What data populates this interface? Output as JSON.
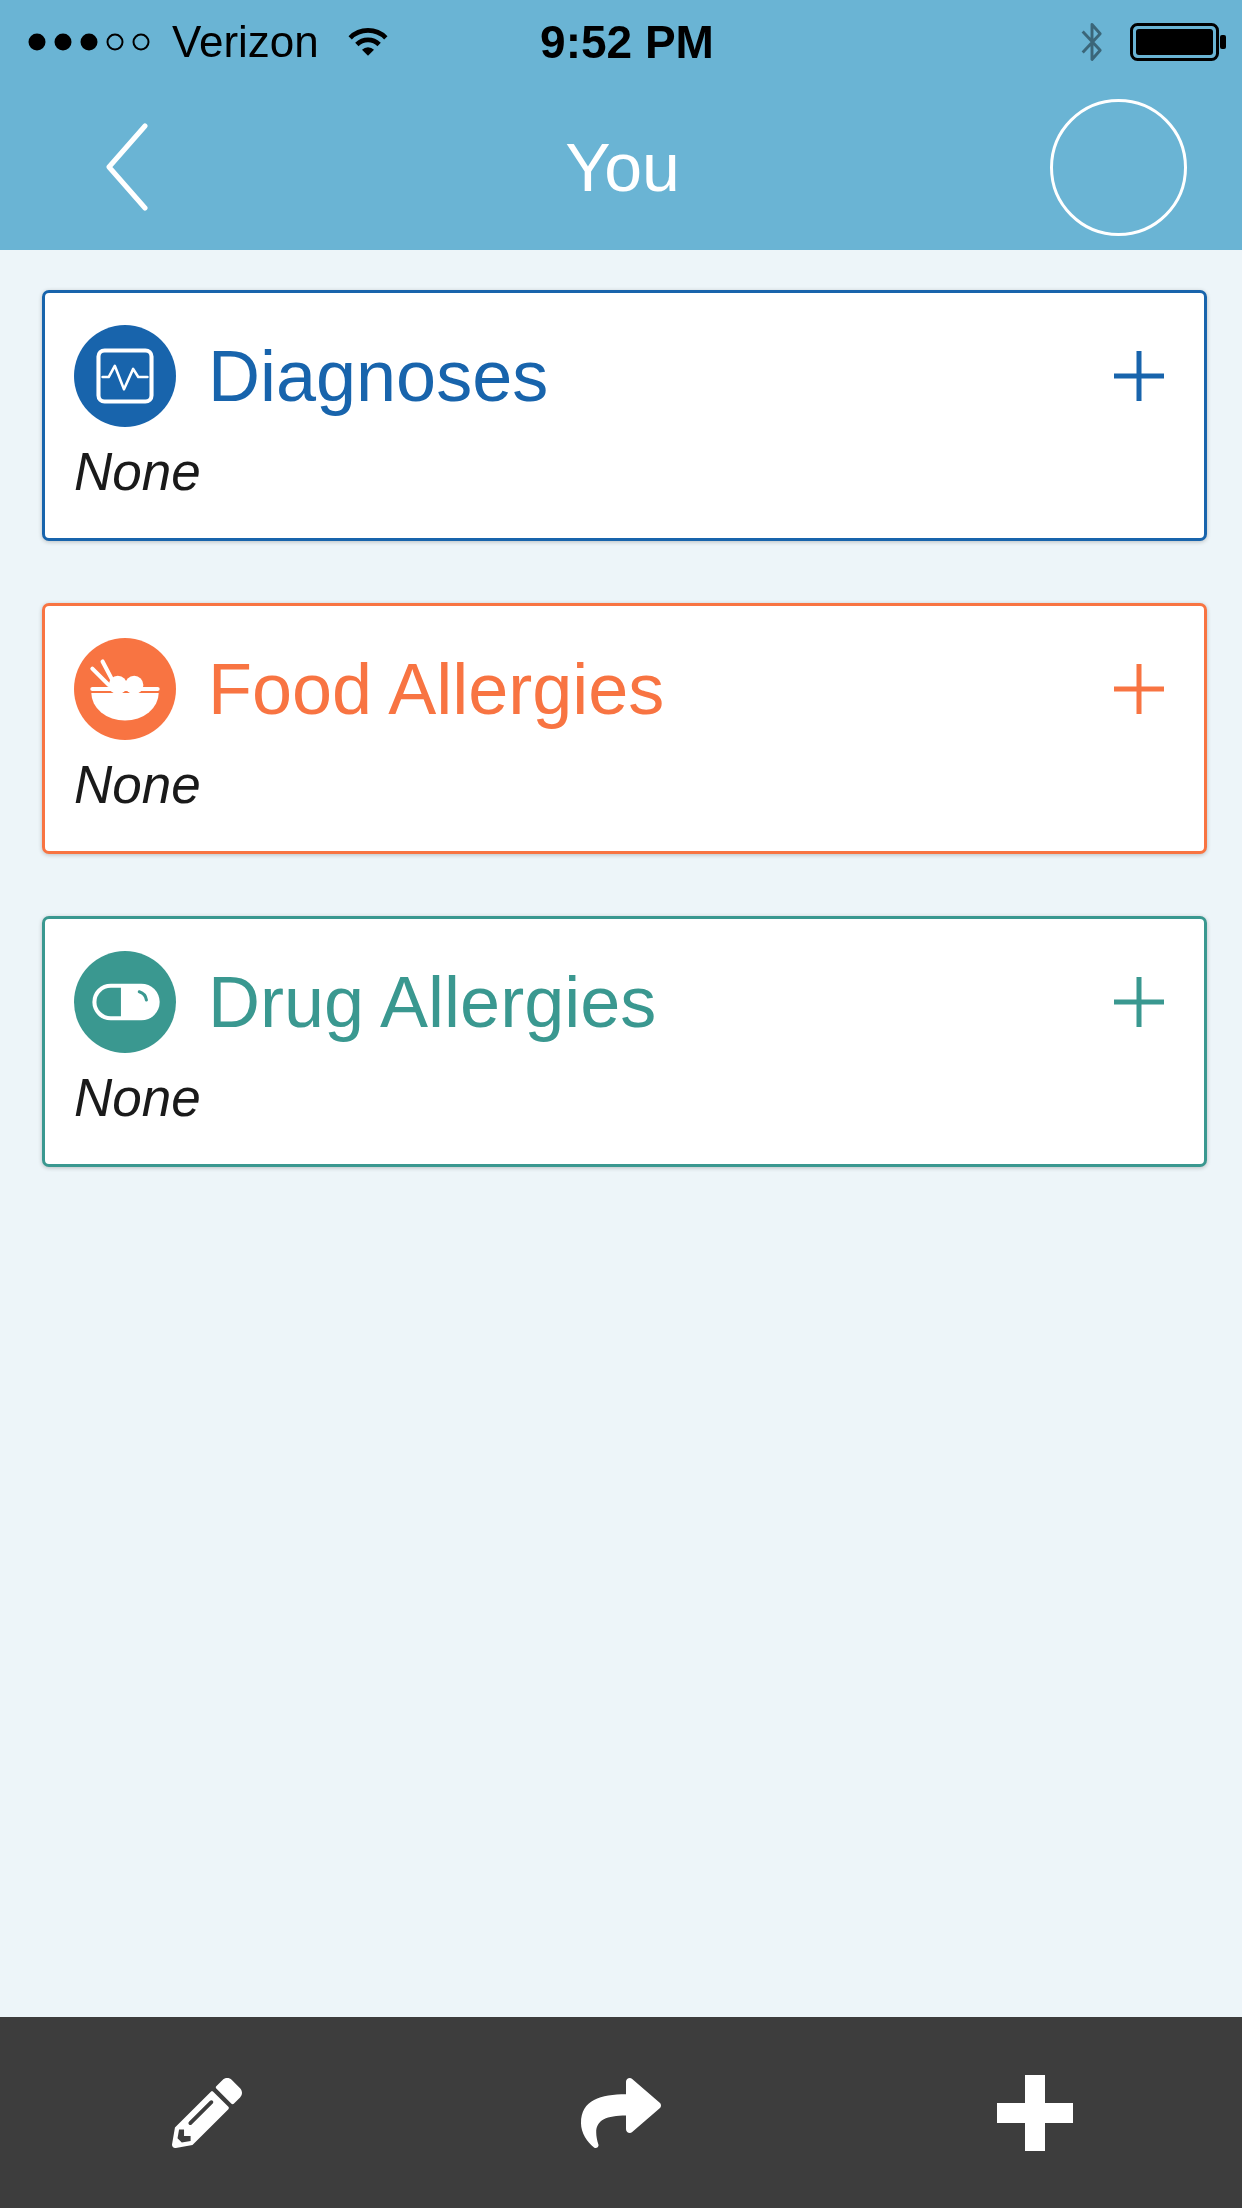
{
  "status_bar": {
    "carrier": "Verizon",
    "time": "9:52 PM"
  },
  "nav_bar": {
    "title": "You"
  },
  "cards": [
    {
      "kind": "diagnoses",
      "title": "Diagnoses",
      "value": "None",
      "color": "#1864ac"
    },
    {
      "kind": "food",
      "title": "Food Allergies",
      "value": "None",
      "color": "#f87442"
    },
    {
      "kind": "drug",
      "title": "Drug Allergies",
      "value": "None",
      "color": "#3a9890"
    }
  ]
}
